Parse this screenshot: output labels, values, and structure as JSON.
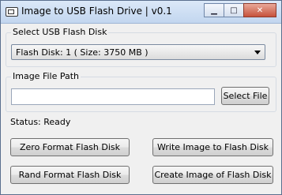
{
  "window": {
    "title": "Image to USB Flash Drive | v0.1"
  },
  "usb_group": {
    "label": "Select USB Flash Disk",
    "selected": "Flash Disk: 1 ( Size: 3750 MB )"
  },
  "image_group": {
    "label": "Image File Path",
    "value": "",
    "select_button": "Select File"
  },
  "status": "Status: Ready",
  "buttons": {
    "zero_format": "Zero Format Flash Disk",
    "write_image": "Write Image to Flash Disk",
    "rand_format": "Rand Format Flash Disk",
    "create_image": "Create Image of Flash Disk"
  }
}
